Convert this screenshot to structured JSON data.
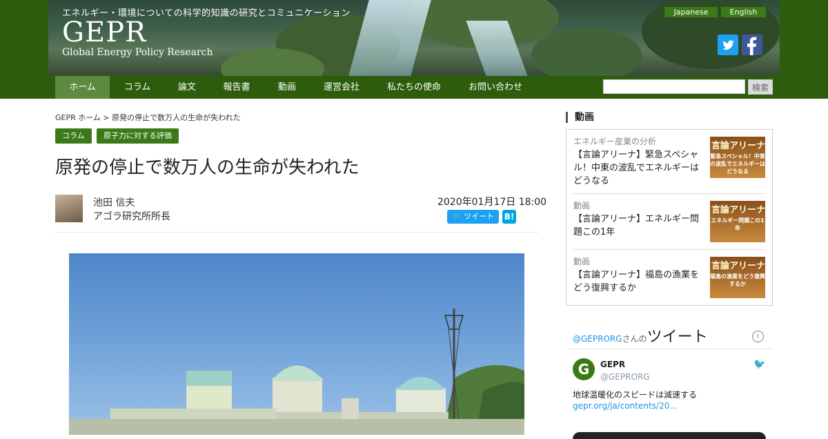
{
  "header": {
    "tagline": "エネルギー・環境についての科学的知識の研究とコミュニケーション",
    "logo": "GEPR",
    "logo_sub": "Global Energy Policy Research",
    "languages": [
      "Japanese",
      "English"
    ],
    "social": [
      "twitter-icon",
      "facebook-icon"
    ]
  },
  "nav": {
    "items": [
      "ホーム",
      "コラム",
      "論文",
      "報告書",
      "動画",
      "運営会社",
      "私たちの使命",
      "お問い合わせ"
    ],
    "active_index": 0,
    "search_button": "検索",
    "search_value": ""
  },
  "article": {
    "breadcrumb": "GEPR ホーム > 原発の停止で数万人の生命が失われた",
    "tags": [
      "コラム",
      "原子力に対する評価"
    ],
    "title": "原発の停止で数万人の生命が失われた",
    "author_name": "池田 信夫",
    "author_title": "アゴラ研究所所長",
    "date": "2020年01月17日 18:00",
    "tweet_label": "ツイート",
    "hatena_label": "B!"
  },
  "sidebar": {
    "videos_heading": "動画",
    "videos": [
      {
        "category": "エネルギー産業の分析",
        "title": "【言論アリーナ】緊急スペシャル！中東の波乱でエネルギーはどうなる",
        "thumb_title": "言論アリーナ",
        "thumb_sub": "緊急スペシャル！中東の波乱でエネルギーはどうなる"
      },
      {
        "category": "動画",
        "title": "【言論アリーナ】エネルギー問題この1年",
        "thumb_title": "言論アリーナ",
        "thumb_sub": "エネルギー問題この1年"
      },
      {
        "category": "動画",
        "title": "【言論アリーナ】福島の漁業をどう復興するか",
        "thumb_title": "言論アリーナ",
        "thumb_sub": "福島の漁業をどう復興するか"
      }
    ],
    "twitter": {
      "handle": "@GEPRORG",
      "suffix": "さんの",
      "heading": "ツイート",
      "name": "GEPR",
      "account": "@GEPRORG",
      "text": "地球温暖化のスピードは減速する",
      "link": "gepr.org/ja/contents/20…",
      "avatar_letter": "G"
    }
  },
  "colors": {
    "brand_green": "#2d5d0c",
    "tag_green": "#3b7a17",
    "twitter_blue": "#1da1f2",
    "facebook_blue": "#3b5998"
  }
}
